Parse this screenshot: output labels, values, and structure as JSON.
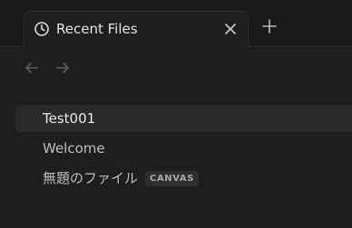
{
  "tab": {
    "title": "Recent Files",
    "icon": "clock-icon",
    "close_icon": "close-icon"
  },
  "toolbar": {
    "new_tab_icon": "plus-icon",
    "back_icon": "arrow-left-icon",
    "forward_icon": "arrow-right-icon"
  },
  "files": [
    {
      "name": "Test001",
      "badge": "",
      "active": true
    },
    {
      "name": "Welcome",
      "badge": "",
      "active": false
    },
    {
      "name": "無題のファイル",
      "badge": "CANVAS",
      "active": false
    }
  ],
  "colors": {
    "background": "#1e1e1e",
    "tabbar": "#1a1a1a",
    "active_row": "#2a2a2a",
    "badge_bg": "#2e2e2e",
    "icon_dim": "#6e6e6e"
  }
}
